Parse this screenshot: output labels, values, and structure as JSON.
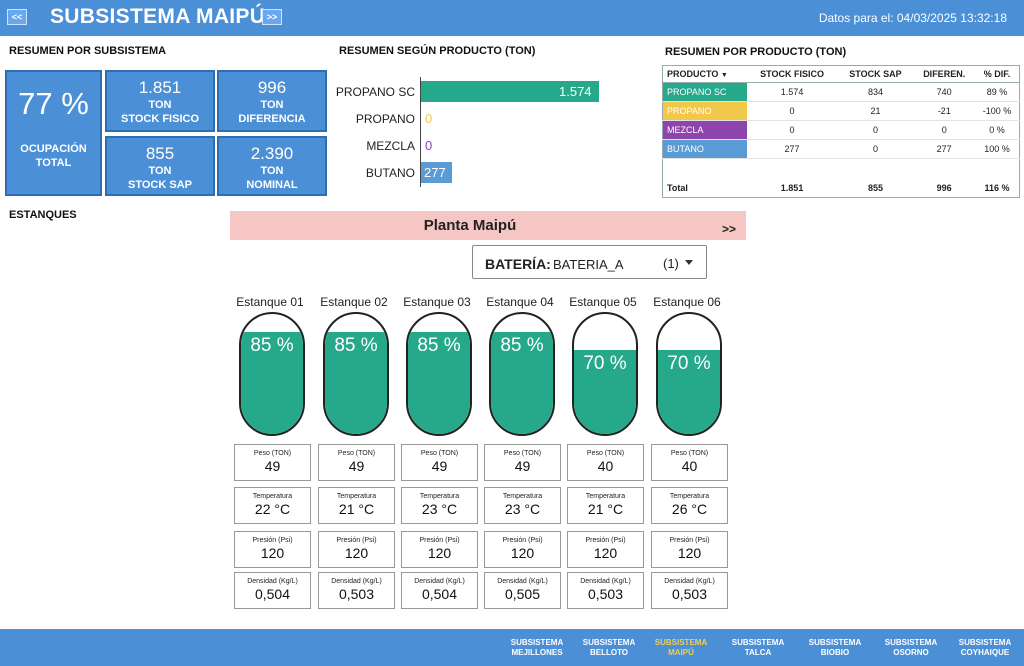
{
  "header": {
    "prev_label": "<<",
    "title": "SUBSISTEMA MAIPÚ",
    "next_label": ">>",
    "date_label": "Datos para el: 04/03/2025 13:32:18"
  },
  "resumen_subsistema": {
    "title": "RESUMEN POR SUBSISTEMA",
    "ocupacion": {
      "value": "77 %",
      "label_line1": "OCUPACIÓN",
      "label_line2": "TOTAL",
      "percent": 77
    },
    "stock_fisico": {
      "value": "1.851",
      "unit": "TON",
      "label": "STOCK FISICO"
    },
    "diferencia": {
      "value": "996",
      "unit": "TON",
      "label": "DIFERENCIA"
    },
    "stock_sap": {
      "value": "855",
      "unit": "TON",
      "label": "STOCK SAP"
    },
    "nominal": {
      "value": "2.390",
      "unit": "TON",
      "label": "NOMINAL"
    }
  },
  "chart_data": {
    "type": "bar",
    "title": "RESUMEN SEGÚN PRODUCTO (TON)",
    "orientation": "horizontal",
    "categories": [
      "PROPANO SC",
      "PROPANO",
      "MEZCLA",
      "BUTANO"
    ],
    "values": [
      1574,
      0,
      0,
      277
    ],
    "value_labels": [
      "1.574",
      "0",
      "0",
      "277"
    ],
    "colors": [
      "#26a98b",
      "#f2c84a",
      "#8e44ad",
      "#5b9bd5"
    ],
    "xlim": [
      0,
      1574
    ]
  },
  "tabla": {
    "title": "RESUMEN POR PRODUCTO (TON)",
    "headers": [
      "PRODUCTO",
      "STOCK FISICO",
      "STOCK SAP",
      "DIFEREN.",
      "% DIF."
    ],
    "rows": [
      {
        "producto": "PROPANO SC",
        "color": "#26a98b",
        "stock_fisico": "1.574",
        "stock_sap": "834",
        "diferencia": "740",
        "dif": "89 %"
      },
      {
        "producto": "PROPANO",
        "color": "#f2c84a",
        "stock_fisico": "0",
        "stock_sap": "21",
        "diferencia": "-21",
        "dif": "-100 %"
      },
      {
        "producto": "MEZCLA",
        "color": "#8e44ad",
        "stock_fisico": "0",
        "stock_sap": "0",
        "diferencia": "0",
        "dif": "0 %"
      },
      {
        "producto": "BUTANO",
        "color": "#5b9bd5",
        "stock_fisico": "277",
        "stock_sap": "0",
        "diferencia": "277",
        "dif": "100 %"
      }
    ],
    "total": {
      "label": "Total",
      "stock_fisico": "1.851",
      "stock_sap": "855",
      "diferencia": "996",
      "dif": "116 %"
    }
  },
  "estanques": {
    "title": "ESTANQUES",
    "planta": "Planta Maipú",
    "planta_next": ">>",
    "bateria_label": "BATERÍA:",
    "bateria_value": "BATERIA_A",
    "bateria_count": "(1)",
    "labels": {
      "peso": "Peso (TON)",
      "temperatura": "Temperatura",
      "presion": "Presión (Psi)",
      "densidad": "Densidad (Kg/L)"
    },
    "items": [
      {
        "name": "Estanque 01",
        "percent": 85,
        "percent_label": "85 %",
        "peso": "49",
        "temperatura": "22 °C",
        "presion": "120",
        "densidad": "0,504"
      },
      {
        "name": "Estanque 02",
        "percent": 85,
        "percent_label": "85 %",
        "peso": "49",
        "temperatura": "21 °C",
        "presion": "120",
        "densidad": "0,503"
      },
      {
        "name": "Estanque 03",
        "percent": 85,
        "percent_label": "85 %",
        "peso": "49",
        "temperatura": "23 °C",
        "presion": "120",
        "densidad": "0,504"
      },
      {
        "name": "Estanque 04",
        "percent": 85,
        "percent_label": "85 %",
        "peso": "49",
        "temperatura": "23 °C",
        "presion": "120",
        "densidad": "0,505"
      },
      {
        "name": "Estanque 05",
        "percent": 70,
        "percent_label": "70 %",
        "peso": "40",
        "temperatura": "21 °C",
        "presion": "120",
        "densidad": "0,503"
      },
      {
        "name": "Estanque 06",
        "percent": 70,
        "percent_label": "70 %",
        "peso": "40",
        "temperatura": "26 °C",
        "presion": "120",
        "densidad": "0,503"
      }
    ]
  },
  "footer": {
    "items": [
      {
        "line1": "SUBSISTEMA",
        "line2": "MEJILLONES",
        "active": false
      },
      {
        "line1": "SUBSISTEMA",
        "line2": "BELLOTO",
        "active": false
      },
      {
        "line1": "SUBSISTEMA",
        "line2": "MAIPÚ",
        "active": true
      },
      {
        "line1": "SUBSISTEMA",
        "line2": "TALCA",
        "active": false
      },
      {
        "line1": "SUBSISTEMA",
        "line2": "BIOBIO",
        "active": false
      },
      {
        "line1": "SUBSISTEMA",
        "line2": "OSORNO",
        "active": false
      },
      {
        "line1": "SUBSISTEMA",
        "line2": "COYHAIQUE",
        "active": false
      }
    ],
    "active_color": "#f2d04a"
  }
}
